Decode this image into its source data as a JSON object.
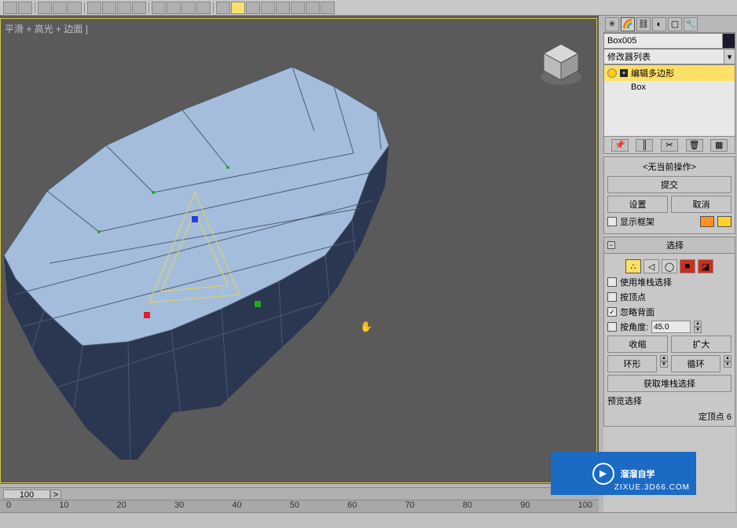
{
  "viewport": {
    "label": "平滑 + 高光 + 边面 ]"
  },
  "object_name": "Box005",
  "modifier_dropdown": "修改器列表",
  "modifier_stack": {
    "items": [
      {
        "label": "编辑多边形",
        "selected": true
      },
      {
        "label": "Box",
        "selected": false
      }
    ]
  },
  "rollouts": {
    "current_op": {
      "title_wrap": "<无当前操作>",
      "commit": "提交",
      "settings": "设置",
      "cancel": "取消",
      "show_cage": "显示框架"
    },
    "selection": {
      "title": "选择",
      "use_stack_sel": "使用堆栈选择",
      "by_vertex": "按顶点",
      "ignore_backface": "忽略背面",
      "by_angle": "按角度:",
      "angle_value": "45.0",
      "shrink": "收缩",
      "grow": "扩大",
      "ring": "环形",
      "loop": "循环",
      "get_stack_sel": "获取堆栈选择",
      "preview_sel": "预览选择",
      "info_suffix": "定顶点 6"
    }
  },
  "timeline": {
    "slider": "100",
    "ticks": [
      "0",
      "10",
      "20",
      "30",
      "40",
      "50",
      "60",
      "70",
      "80",
      "90",
      "100"
    ]
  },
  "watermark": {
    "text": "溜溜自学",
    "sub": "ZIXUE.3D66.COM"
  }
}
